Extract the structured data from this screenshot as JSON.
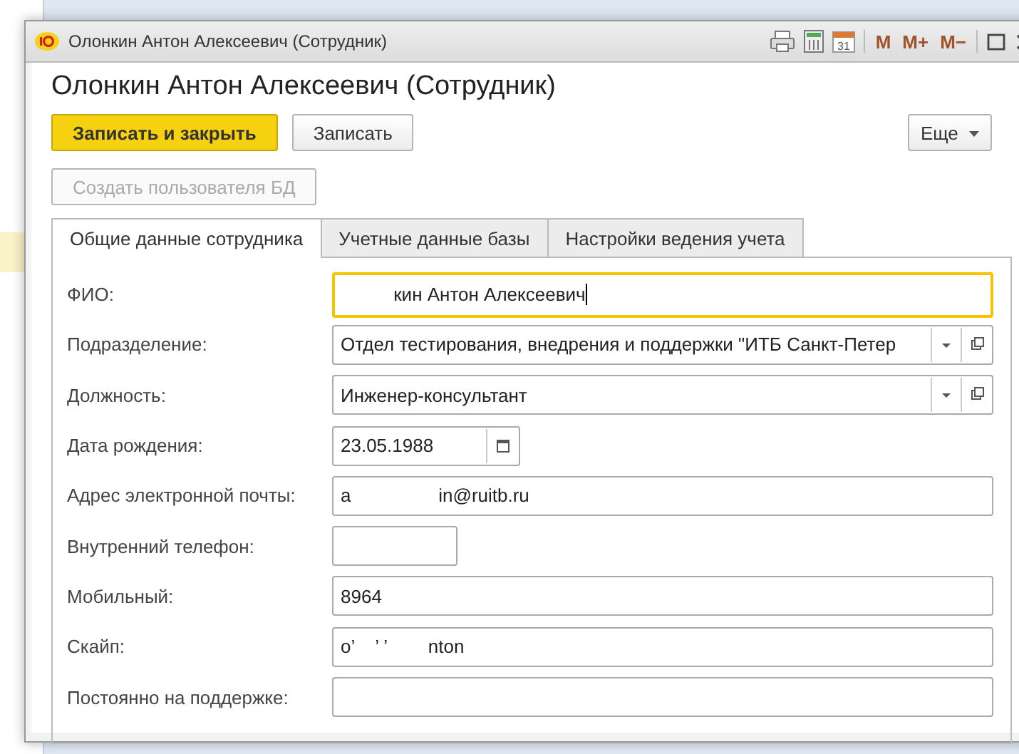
{
  "window": {
    "title": "Олонкин Антон Алексеевич (Сотрудник)",
    "calendar_day": "31",
    "memory_buttons": [
      "M",
      "M+",
      "M−"
    ]
  },
  "header": {
    "title": "Олонкин Антон Алексеевич (Сотрудник)"
  },
  "toolbar": {
    "primary": "Записать и закрыть",
    "secondary": "Записать",
    "more": "Еще"
  },
  "create_user": {
    "label": "Создать пользователя БД",
    "disabled": true
  },
  "tabs": [
    {
      "label": "Общие данные сотрудника",
      "selected": true
    },
    {
      "label": "Учетные данные базы",
      "selected": false
    },
    {
      "label": "Настройки ведения учета",
      "selected": false
    }
  ],
  "fields": [
    {
      "label": "ФИО:",
      "kind": "text",
      "value": "          кин Антон Алексеевич",
      "focused": true
    },
    {
      "label": "Подразделение:",
      "kind": "combo",
      "value": "Отдел тестирования, внедрения и поддержки \"ИТБ Санкт-Петер",
      "focused": false
    },
    {
      "label": "Должность:",
      "kind": "combo",
      "value": "Инженер-консультант",
      "focused": false
    },
    {
      "label": "Дата рождения:",
      "kind": "date",
      "value": "23.05.1988",
      "focused": false
    },
    {
      "label": "Адрес электронной почты:",
      "kind": "text",
      "value": "a                 in@ruitb.ru",
      "focused": false
    },
    {
      "label": "Внутренний телефон:",
      "kind": "short",
      "focused": false
    },
    {
      "label": "Мобильный:",
      "kind": "text",
      "value": "8964",
      "focused": false
    },
    {
      "label": "Скайп:",
      "kind": "text",
      "value": "o’    ’ ’        nton",
      "focused": false
    },
    {
      "label": "Постоянно на поддержке:",
      "kind": "text",
      "focused": false
    }
  ]
}
